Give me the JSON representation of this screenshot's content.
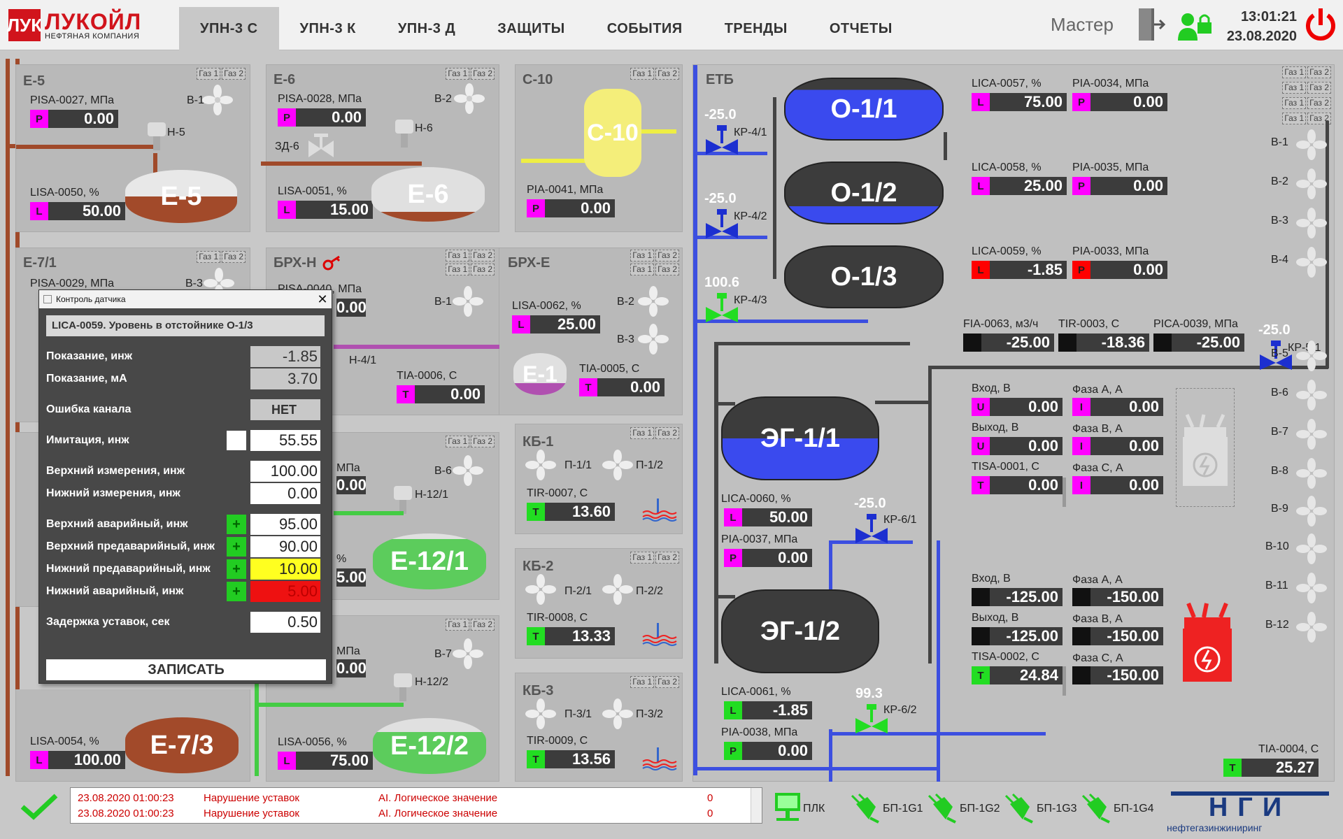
{
  "header": {
    "logo_mark": "ЛУК",
    "logo_name": "ЛУКОЙЛ",
    "logo_sub": "НЕФТЯНАЯ КОМПАНИЯ",
    "tabs": [
      "УПН-3 С",
      "УПН-3 К",
      "УПН-3 Д",
      "ЗАЩИТЫ",
      "СОБЫТИЯ",
      "ТРЕНДЫ",
      "ОТЧЕТЫ"
    ],
    "user": "Мастер",
    "time": "13:01:21",
    "date": "23.08.2020"
  },
  "gas": [
    "Газ 1",
    "Газ 2"
  ],
  "panels": {
    "e5": {
      "title": "Е-5",
      "p_label": "PISA-0027, МПа",
      "p_tag": "P",
      "p_val": "0.00",
      "l_label": "LISA-0050, %",
      "l_tag": "L",
      "l_val": "50.00",
      "fan": "В-1",
      "pump": "Н-5",
      "tank": "Е-5"
    },
    "e6": {
      "title": "Е-6",
      "p_label": "PISA-0028, МПа",
      "p_tag": "P",
      "p_val": "0.00",
      "l_label": "LISA-0051, %",
      "l_tag": "L",
      "l_val": "15.00",
      "fan": "В-2",
      "pump": "Н-6",
      "valve": "ЗД-6",
      "tank": "Е-6"
    },
    "c10": {
      "title": "С-10",
      "p_label": "PIA-0041, МПа",
      "p_tag": "P",
      "p_val": "0.00",
      "tank": "С-10"
    },
    "e71": {
      "title": "Е-7/1",
      "p_label": "PISA-0029, МПа",
      "fan": "В-3"
    },
    "brxn": {
      "title": "БРХ-Н",
      "p_label": "PISA-0040, МПа",
      "p_val": "0.00",
      "fan": "В-1",
      "pump": "Н-4/1",
      "t_label": "TIA-0006, С",
      "t_tag": "T",
      "t_val": "0.00"
    },
    "brxe": {
      "title": "БРХ-Е",
      "l_label": "LISA-0062, %",
      "l_tag": "L",
      "l_val": "25.00",
      "fan1": "В-2",
      "fan2": "В-3",
      "t_label": "TIA-0005, С",
      "t_tag": "T",
      "t_val": "0.00",
      "tank": "Е-1"
    },
    "e121": {
      "p_label": "МПа",
      "p_val": "0.00",
      "fan": "В-6",
      "pump": "Н-12/1",
      "l_label": "%",
      "l_val": "5.00",
      "tank": "Е-12/1"
    },
    "e122": {
      "p_label": "МПа",
      "p_val": "0.00",
      "fan": "В-7",
      "pump": "Н-12/2",
      "l_label": "LISA-0056, %",
      "l_tag": "L",
      "l_val": "75.00",
      "tank": "Е-12/2"
    },
    "e73": {
      "l_label": "LISA-0054, %",
      "l_tag": "L",
      "l_val": "100.00",
      "tank": "Е-7/3"
    },
    "kb1": {
      "title": "КБ-1",
      "f1": "П-1/1",
      "f2": "П-1/2",
      "t_label": "TIR-0007, С",
      "t_tag": "T",
      "t_val": "13.60"
    },
    "kb2": {
      "title": "КБ-2",
      "f1": "П-2/1",
      "f2": "П-2/2",
      "t_label": "TIR-0008, С",
      "t_tag": "T",
      "t_val": "13.33"
    },
    "kb3": {
      "title": "КБ-3",
      "f1": "П-3/1",
      "f2": "П-3/2",
      "t_label": "TIR-0009, С",
      "t_tag": "T",
      "t_val": "13.56"
    },
    "etb": {
      "title": "ЕТБ",
      "o1": "О-1/1",
      "o2": "О-1/2",
      "o3": "О-1/3",
      "eg1": "ЭГ-1/1",
      "eg2": "ЭГ-1/2",
      "kr41": {
        "label": "КР-4/1",
        "val": "-25.0"
      },
      "kr42": {
        "label": "КР-4/2",
        "val": "-25.0"
      },
      "kr43": {
        "label": "КР-4/3",
        "val": "100.6"
      },
      "kr51": {
        "label": "КР-5/1",
        "val": "-25.0"
      },
      "kr61": {
        "label": "КР-6/1",
        "val": "-25.0"
      },
      "kr62": {
        "label": "КР-6/2",
        "val": "99.3"
      },
      "lica57": {
        "label": "LICA-0057, %",
        "tag": "L",
        "val": "75.00"
      },
      "pia34": {
        "label": "PIA-0034, МПа",
        "tag": "P",
        "val": "0.00"
      },
      "lica58": {
        "label": "LICA-0058, %",
        "tag": "L",
        "val": "25.00"
      },
      "pia35": {
        "label": "PIA-0035, МПа",
        "tag": "P",
        "val": "0.00"
      },
      "lica59": {
        "label": "LICA-0059, %",
        "tag": "L",
        "val": "-1.85"
      },
      "pia33": {
        "label": "PIA-0033, МПа",
        "tag": "P",
        "val": "0.00"
      },
      "fia63": {
        "label": "FIA-0063, м3/ч",
        "val": "-25.00"
      },
      "tir03": {
        "label": "TIR-0003, С",
        "val": "-18.36"
      },
      "pica39": {
        "label": "PICA-0039, МПа",
        "val": "-25.00"
      },
      "lica60": {
        "label": "LICA-0060, %",
        "tag": "L",
        "val": "50.00"
      },
      "pia37": {
        "label": "PIA-0037, МПа",
        "tag": "P",
        "val": "0.00"
      },
      "lica61": {
        "label": "LICA-0061, %",
        "tag": "L",
        "val": "-1.85"
      },
      "pia38": {
        "label": "PIA-0038, МПа",
        "tag": "P",
        "val": "0.00"
      },
      "in1": {
        "label": "Вход, В",
        "tag": "U",
        "val": "0.00"
      },
      "out1": {
        "label": "Выход, В",
        "tag": "U",
        "val": "0.00"
      },
      "tisa1": {
        "label": "TISA-0001, С",
        "tag": "T",
        "val": "0.00"
      },
      "fa1": {
        "label": "Фаза А, А",
        "tag": "I",
        "val": "0.00"
      },
      "fb1": {
        "label": "Фаза В, А",
        "tag": "I",
        "val": "0.00"
      },
      "fc1": {
        "label": "Фаза С, А",
        "tag": "I",
        "val": "0.00"
      },
      "in2": {
        "label": "Вход, В",
        "val": "-125.00"
      },
      "out2": {
        "label": "Выход, В",
        "val": "-125.00"
      },
      "tisa2": {
        "label": "TISA-0002, С",
        "tag": "T",
        "val": "24.84"
      },
      "fa2": {
        "label": "Фаза А, А",
        "val": "-150.00"
      },
      "fb2": {
        "label": "Фаза В, А",
        "val": "-150.00"
      },
      "fc2": {
        "label": "Фаза С, А",
        "val": "-150.00"
      },
      "tia04": {
        "label": "TIA-0004, С",
        "tag": "T",
        "val": "25.27"
      },
      "fans": [
        "В-1",
        "В-2",
        "В-3",
        "В-4",
        "В-5",
        "В-6",
        "В-7",
        "В-8",
        "В-9",
        "В-10",
        "В-11",
        "В-12"
      ]
    }
  },
  "dialog": {
    "window_title": "Контроль датчика",
    "close": "✕",
    "title": "LICA-0059. Уровень в отстойнике О-1/3",
    "rows": [
      {
        "label": "Показание, инж",
        "value": "-1.85"
      },
      {
        "label": "Показание, мА",
        "value": "3.70"
      },
      {
        "label": "Ошибка канала",
        "value": "НЕТ"
      },
      {
        "label": "Имитация, инж",
        "value": "55.55"
      },
      {
        "label": "Верхний измерения, инж",
        "value": "100.00"
      },
      {
        "label": "Нижний измерения, инж",
        "value": "0.00"
      },
      {
        "label": "Верхний аварийный, инж",
        "value": "95.00"
      },
      {
        "label": "Верхний предаварийный, инж",
        "value": "90.00"
      },
      {
        "label": "Нижний предаварийный, инж",
        "value": "10.00"
      },
      {
        "label": "Нижний аварийный, инж",
        "value": "5.00"
      },
      {
        "label": "Задержка уставок, сек",
        "value": "0.50"
      }
    ],
    "plus": "+",
    "button": "ЗАПИСАТЬ"
  },
  "status": {
    "log": [
      {
        "time": "23.08.2020 01:00:23",
        "event": "Нарушение уставок",
        "type": "AI. Логическое значение",
        "value": "0"
      },
      {
        "time": "23.08.2020 01:00:23",
        "event": "Нарушение уставок",
        "type": "AI. Логическое значение",
        "value": "0"
      }
    ],
    "plc": "ПЛК",
    "bp": [
      "БП-1G1",
      "БП-1G2",
      "БП-1G3",
      "БП-1G4"
    ],
    "brand": "НГИ",
    "brand_sub": "нефтегазинжиниринг"
  }
}
